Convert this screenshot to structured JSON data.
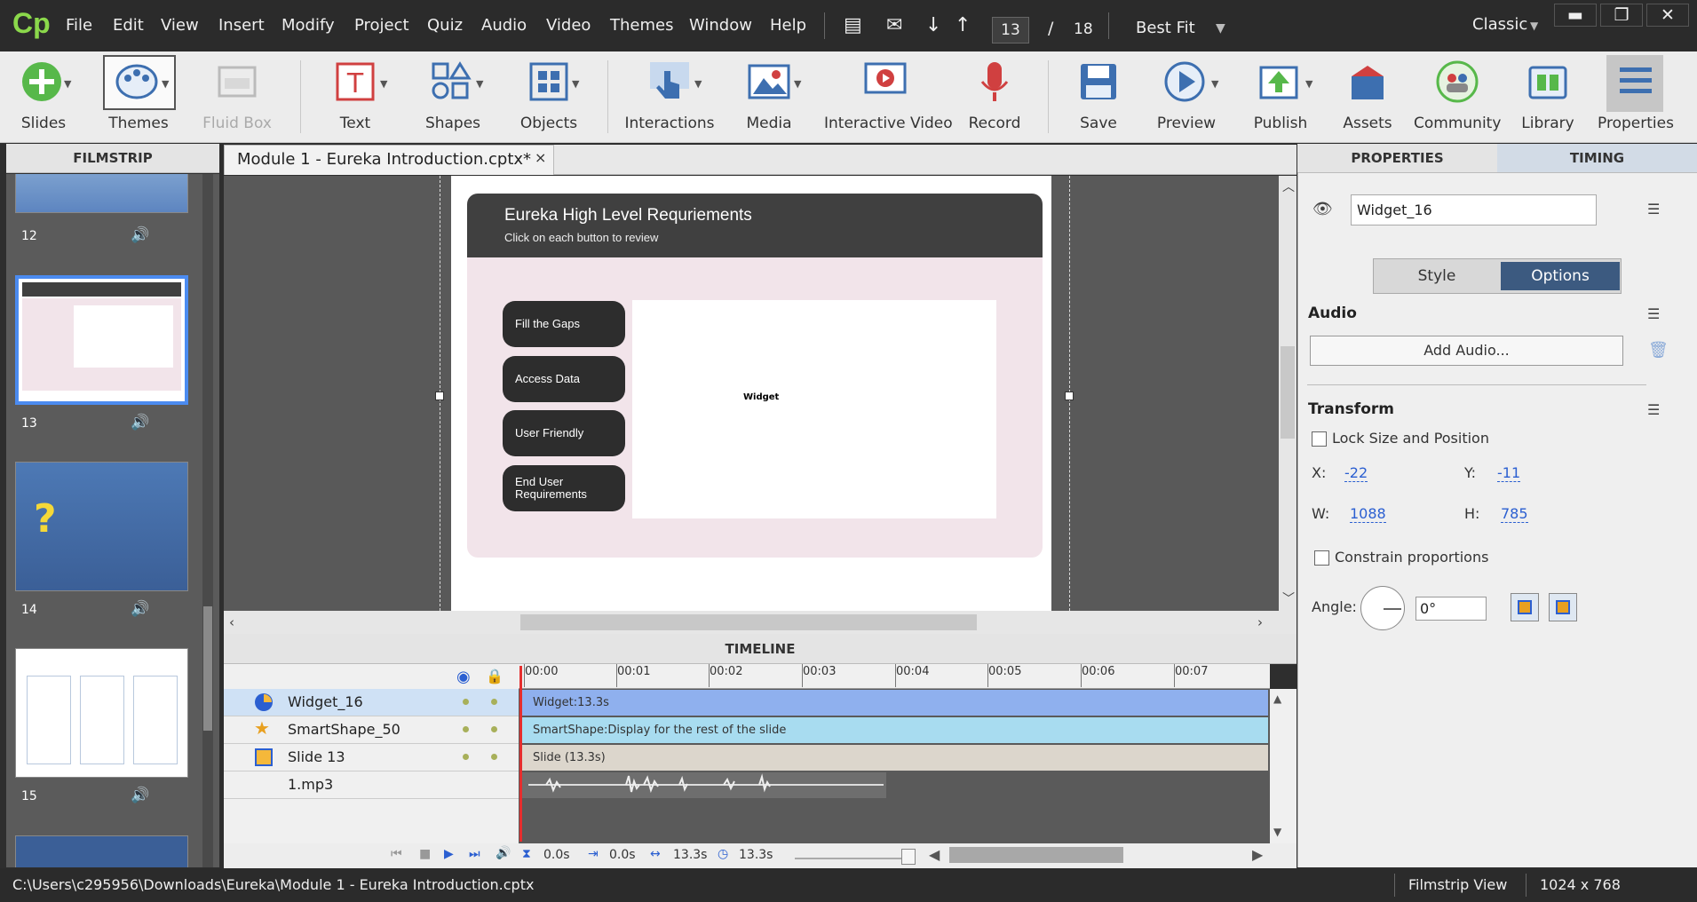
{
  "app": {
    "logo": "Cp"
  },
  "menu": [
    "File",
    "Edit",
    "View",
    "Insert",
    "Modify",
    "Project",
    "Quiz",
    "Audio",
    "Video",
    "Themes",
    "Window",
    "Help"
  ],
  "nav": {
    "current_slide": "13",
    "separator": "/",
    "total_slides": "18",
    "zoom": "Best Fit",
    "workspace": "Classic"
  },
  "toolbar": {
    "slides": "Slides",
    "themes": "Themes",
    "fluid_box": "Fluid Box",
    "text": "Text",
    "shapes": "Shapes",
    "objects": "Objects",
    "interactions": "Interactions",
    "media": "Media",
    "interactive_video": "Interactive Video",
    "record": "Record",
    "save": "Save",
    "preview": "Preview",
    "publish": "Publish",
    "assets": "Assets",
    "community": "Community",
    "library": "Library",
    "properties": "Properties"
  },
  "panels": {
    "filmstrip": "FILMSTRIP",
    "properties": "PROPERTIES",
    "timing": "TIMING",
    "timeline": "TIMELINE"
  },
  "document_tab": {
    "title": "Module 1 - Eureka Introduction.cptx*",
    "close": "×"
  },
  "filmstrip": {
    "slides": [
      "12",
      "13",
      "14",
      "15"
    ]
  },
  "slide": {
    "title": "Eureka High Level Requriements",
    "subtitle": "Click on each button to review",
    "buttons": [
      "Fill the Gaps",
      "Access Data",
      "User Friendly",
      "End User Requirements"
    ],
    "widget_label": "Widget"
  },
  "timeline": {
    "ruler": [
      "00:00",
      "00:01",
      "00:02",
      "00:03",
      "00:04",
      "00:05",
      "00:06",
      "00:07"
    ],
    "rows": [
      {
        "name": "Widget_16",
        "bar": "Widget:13.3s"
      },
      {
        "name": "SmartShape_50",
        "bar": "SmartShape:Display for the rest of the slide"
      },
      {
        "name": "Slide 13",
        "bar": "Slide (13.3s)"
      },
      {
        "name": "1.mp3",
        "bar": ""
      }
    ],
    "footer": {
      "start": "0.0s",
      "in": "0.0s",
      "duration": "13.3s",
      "total": "13.3s"
    }
  },
  "properties": {
    "object_name": "Widget_16",
    "tab_style": "Style",
    "tab_options": "Options",
    "audio_section": "Audio",
    "add_audio": "Add Audio...",
    "transform_section": "Transform",
    "lock_size": "Lock Size and Position",
    "x_label": "X:",
    "x": "-22",
    "y_label": "Y:",
    "y": "-11",
    "w_label": "W:",
    "w": "1088",
    "h_label": "H:",
    "h": "785",
    "constrain": "Constrain proportions",
    "angle_label": "Angle:",
    "angle": "0°"
  },
  "status": {
    "path": "C:\\Users\\c295956\\Downloads\\Eureka\\Module 1 - Eureka Introduction.cptx",
    "view": "Filmstrip View",
    "size": "1024 x 768"
  },
  "colors": {
    "accent": "#4b8bf0",
    "logo": "#8bd84b",
    "options_tab": "#3c5a80",
    "playhead": "#e52e2e"
  }
}
